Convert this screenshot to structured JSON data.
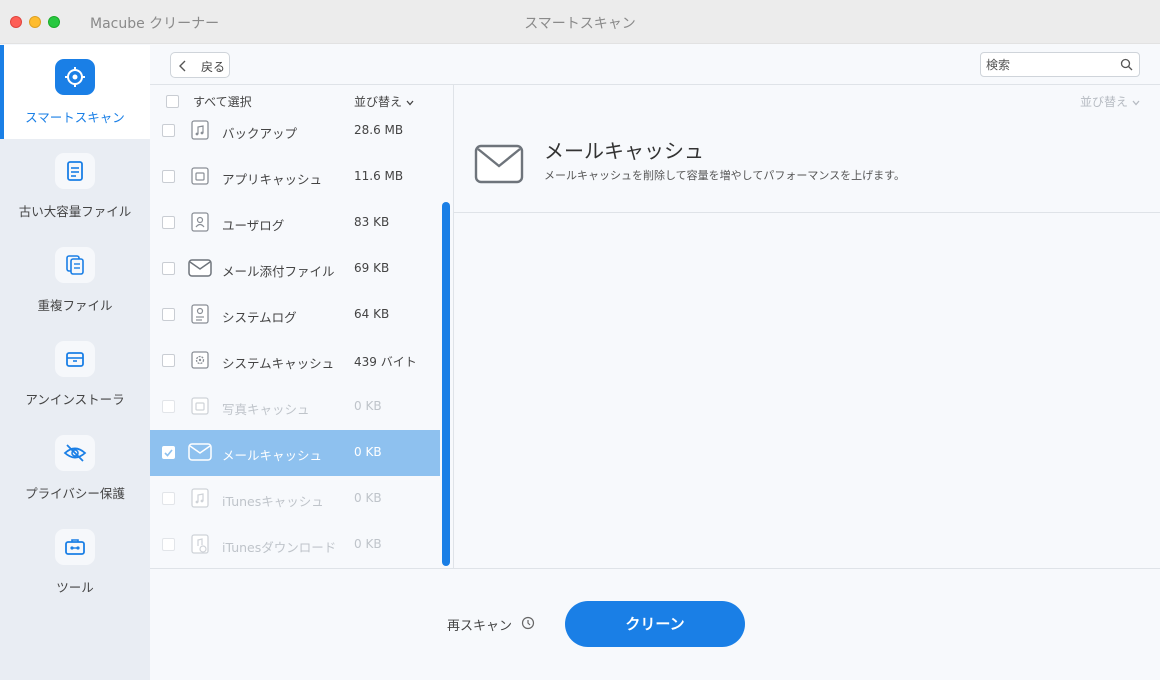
{
  "window": {
    "app_title": "Macube クリーナー",
    "title": "スマートスキャン"
  },
  "sidebar": {
    "items": [
      {
        "label": "スマートスキャン",
        "icon": "target-icon",
        "active": true
      },
      {
        "label": "古い大容量ファイル",
        "icon": "document-icon",
        "active": false
      },
      {
        "label": "重複ファイル",
        "icon": "duplicate-icon",
        "active": false
      },
      {
        "label": "アンインストーラ",
        "icon": "box-icon",
        "active": false
      },
      {
        "label": "プライバシー保護",
        "icon": "eye-slash-icon",
        "active": false
      },
      {
        "label": "ツール",
        "icon": "toolbox-icon",
        "active": false
      }
    ]
  },
  "toolbar": {
    "back_label": "戻る",
    "search_placeholder": "検索"
  },
  "list": {
    "select_all_label": "すべて選択",
    "sort_label": "並び替え",
    "items": [
      {
        "name": "バックアップ",
        "size": "28.6 MB",
        "icon": "music-icon",
        "state": "normal"
      },
      {
        "name": "アプリキャッシュ",
        "size": "11.6 MB",
        "icon": "app-cache-icon",
        "state": "normal"
      },
      {
        "name": "ユーザログ",
        "size": "83 KB",
        "icon": "user-log-icon",
        "state": "normal"
      },
      {
        "name": "メール添付ファイル",
        "size": "69 KB",
        "icon": "mail-icon",
        "state": "normal"
      },
      {
        "name": "システムログ",
        "size": "64 KB",
        "icon": "system-log-icon",
        "state": "normal"
      },
      {
        "name": "システムキャッシュ",
        "size": "439 バイト",
        "icon": "gear-icon",
        "state": "normal"
      },
      {
        "name": "写真キャッシュ",
        "size": "0 KB",
        "icon": "photo-icon",
        "state": "disabled"
      },
      {
        "name": "メールキャッシュ",
        "size": "0 KB",
        "icon": "mail-icon",
        "state": "selected"
      },
      {
        "name": "iTunesキャッシュ",
        "size": "0 KB",
        "icon": "music-icon",
        "state": "disabled"
      },
      {
        "name": "iTunesダウンロード",
        "size": "0 KB",
        "icon": "download-icon",
        "state": "disabled"
      }
    ]
  },
  "detail": {
    "sort_label": "並び替え",
    "title": "メールキャッシュ",
    "description": "メールキャッシュを削除して容量を増やしてパフォーマンスを上げます。"
  },
  "footer": {
    "rescan_label": "再スキャン",
    "clean_label": "クリーン"
  },
  "colors": {
    "accent": "#1a7fe6",
    "selected_row": "#8ec1ef",
    "sidebar_bg": "#e9edf3"
  }
}
